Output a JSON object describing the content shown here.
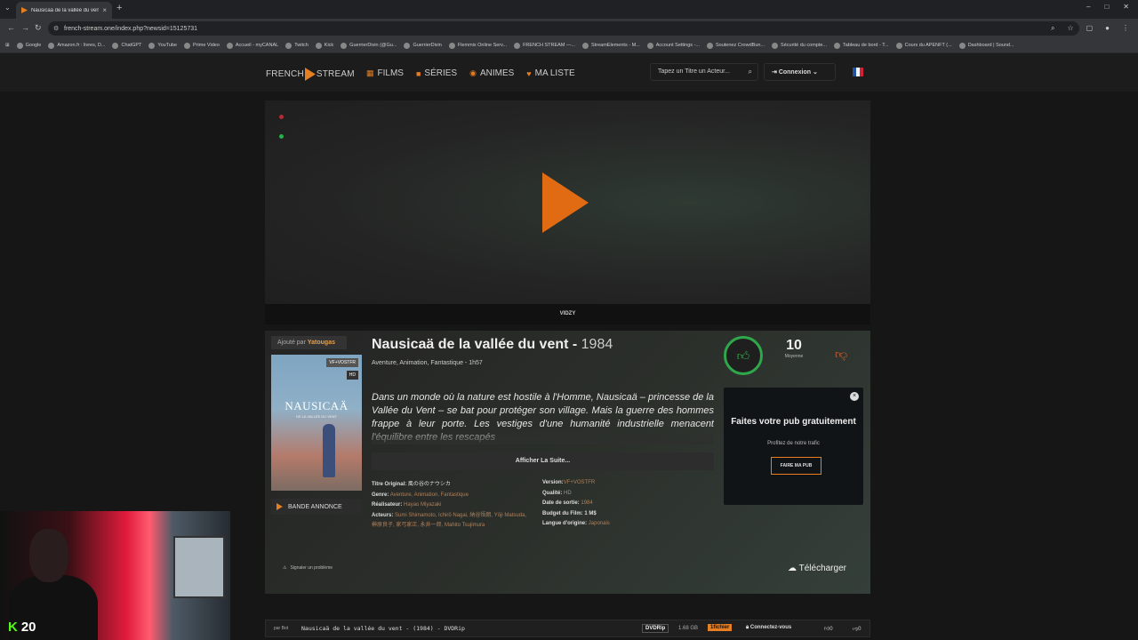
{
  "browser": {
    "tab_title": "Nausicaä de la vallée du vent -",
    "url": "french-stream.one/index.php?newsid=15125731",
    "bookmarks": [
      "Google",
      "Amazon.fr : livres, D...",
      "ChatGPT",
      "YouTube",
      "Prime Video",
      "Accueil - myCANAL",
      "Twitch",
      "Kick",
      "GuerrierDivin (@Gu...",
      "GuerrierDivin",
      "Flemmix Online Serv...",
      "FRENCH STREAM —...",
      "StreamElements - M...",
      "Account Settings -...",
      "Soutenez CrowdBun...",
      "Sécurité du compte...",
      "Tableau de bord - T...",
      "Cours du APENFT (...",
      "Dashboard | Sound..."
    ]
  },
  "site": {
    "logo_left": "FRENCH",
    "logo_right": "STREAM",
    "nav": [
      "FILMS",
      "SÉRIES",
      "ANIMES",
      "MA LISTE"
    ],
    "search_placeholder": "Tapez un Titre un Acteur...",
    "login": "Connexion"
  },
  "player": {
    "label": "VIDZY"
  },
  "movie": {
    "added_by_prefix": "Ajouté par",
    "added_by": "Yatougas",
    "poster_title": "NAUSICAÄ",
    "poster_sub": "DE LA VALLÉE DU VENT",
    "poster_badge1": "VF+VOSTFR",
    "poster_badge2": "HD",
    "trailer": "BANDE ANNONCE",
    "title": "Nausicaä de la vallée du vent",
    "year": "1984",
    "genres_line": "Aventure, Animation, Fantastique - 1h57",
    "synopsis": "Dans un monde où la nature est hostile à l'Homme, Nausicaä – princesse de la Vallée du Vent – se bat pour protéger son village. Mais la guerre des hommes frappe à leur porte. Les vestiges d'une humanité industrielle menacent l'équilibre entre les rescapés",
    "read_more": "Afficher La Suite...",
    "rating": "10",
    "rating_label": "Moyenne",
    "details": {
      "original_title_label": "Titre Original:",
      "original_title": "風の谷のナウシカ",
      "genre_label": "Genre:",
      "genre": "Aventure, Animation, Fantastique",
      "director_label": "Réalisateur:",
      "director": "Hayao Miyazaki",
      "actors_label": "Acteurs:",
      "actors": "Sumi Shimamoto, Ichirō Nagai, 納谷悟朗, Yōji Matsuda, 榊原良子, 家弓家正, 永井一郎, Mahito Tsujimura",
      "version_label": "Version:",
      "version": "VF+VOSTFR",
      "quality_label": "Qualité:",
      "quality": "HD",
      "release_label": "Date de sortie:",
      "release": "1984",
      "budget_label": "Budget du Film:",
      "budget": "1 M$",
      "language_label": "Langue d'origine:",
      "language": "Japonais"
    },
    "report": "Signaler un problème",
    "download": "Télécharger"
  },
  "ad": {
    "headline": "Faites votre pub gratuitement",
    "sub": "Profitez de notre trafic",
    "cta": "FAIRE MA PUB"
  },
  "link_row": {
    "by": "par Bot",
    "file": "Nausicaä de la vallée du vent - (1984) - DVDRip",
    "quality": "DVDRip",
    "size": "1.68 GB",
    "host": "1fichier",
    "connect": "Connectez-vous",
    "up": "0",
    "down": "0"
  },
  "stream_overlay": {
    "viewers": "20"
  }
}
